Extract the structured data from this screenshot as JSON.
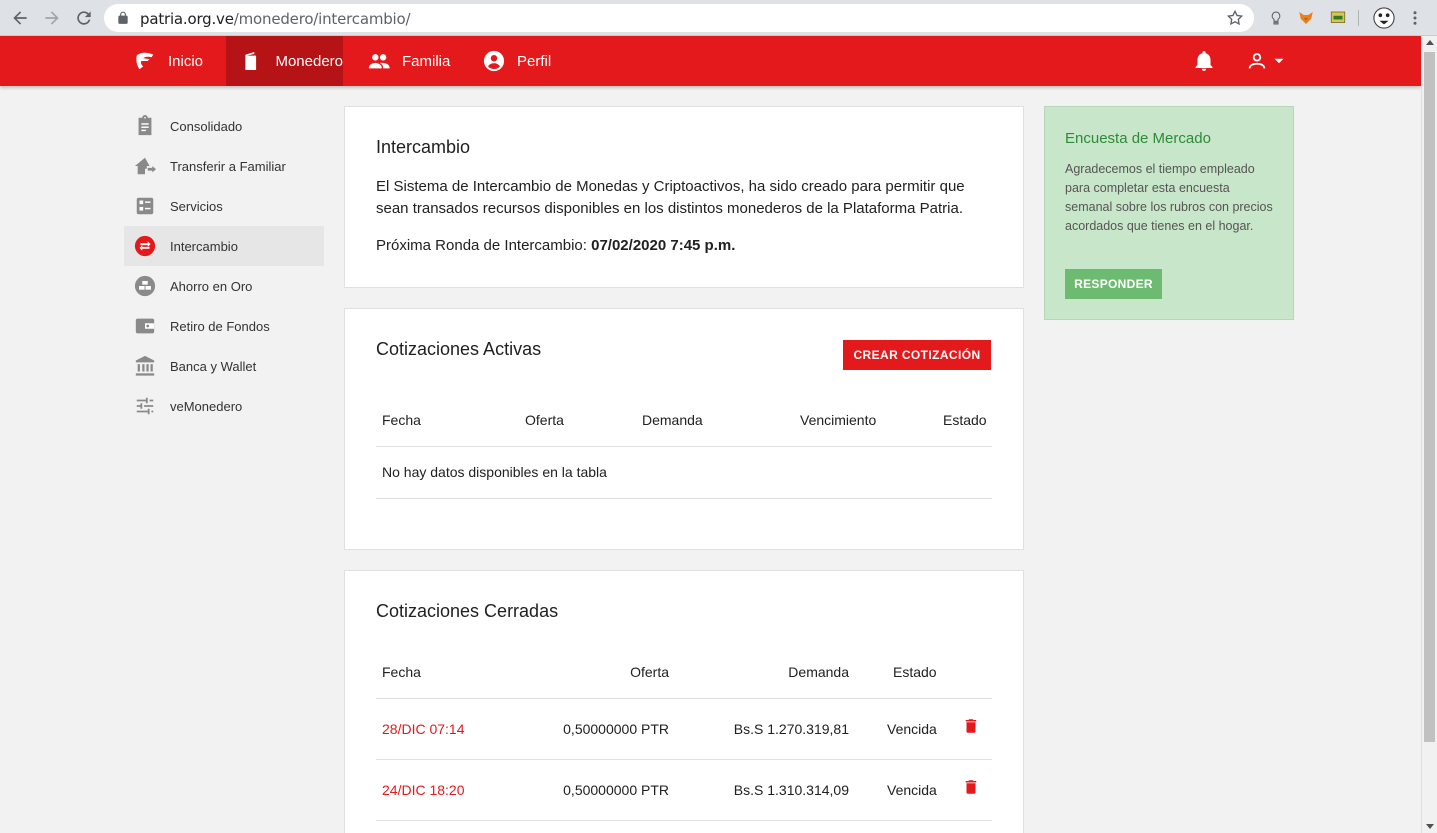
{
  "browser": {
    "url_host": "patria.org.ve",
    "url_path": "/monedero/intercambio/"
  },
  "topnav": {
    "items": [
      {
        "label": "Inicio",
        "icon": "patria-logo-icon"
      },
      {
        "label": "Monedero",
        "icon": "wallet-icon",
        "active": true
      },
      {
        "label": "Familia",
        "icon": "people-icon"
      },
      {
        "label": "Perfil",
        "icon": "account-circle-icon"
      }
    ]
  },
  "sidebar": {
    "items": [
      {
        "label": "Consolidado",
        "icon": "clipboard-icon"
      },
      {
        "label": "Transferir a Familiar",
        "icon": "home-transfer-icon"
      },
      {
        "label": "Servicios",
        "icon": "list-icon"
      },
      {
        "label": "Intercambio",
        "icon": "swap-icon",
        "active": true
      },
      {
        "label": "Ahorro en Oro",
        "icon": "gold-bars-icon"
      },
      {
        "label": "Retiro de Fondos",
        "icon": "wallet-withdraw-icon"
      },
      {
        "label": "Banca y Wallet",
        "icon": "bank-icon"
      },
      {
        "label": "veMonedero",
        "icon": "sliders-icon"
      }
    ]
  },
  "intro": {
    "title": "Intercambio",
    "description": "El Sistema de Intercambio de Monedas y Criptoactivos, ha sido creado para permitir que sean transados recursos disponibles en los distintos monederos de la Plataforma Patria.",
    "round_label": "Próxima Ronda de Intercambio: ",
    "round_value": "07/02/2020 7:45 p.m."
  },
  "active_quotes": {
    "title": "Cotizaciones Activas",
    "create_button": "CREAR COTIZACIÓN",
    "columns": [
      "Fecha",
      "Oferta",
      "Demanda",
      "Vencimiento",
      "Estado"
    ],
    "empty_message": "No hay datos disponibles en la tabla"
  },
  "closed_quotes": {
    "title": "Cotizaciones Cerradas",
    "columns": [
      "Fecha",
      "Oferta",
      "Demanda",
      "Estado"
    ],
    "rows": [
      {
        "fecha": "28/DIC 07:14",
        "oferta": "0,50000000 PTR",
        "demanda": "Bs.S 1.270.319,81",
        "estado": "Vencida"
      },
      {
        "fecha": "24/DIC 18:20",
        "oferta": "0,50000000 PTR",
        "demanda": "Bs.S 1.310.314,09",
        "estado": "Vencida"
      }
    ]
  },
  "survey": {
    "title": "Encuesta de Mercado",
    "text": "Agradecemos el tiempo empleado para completar esta encuesta semanal sobre los rubros con precios acordados que tienes en el hogar.",
    "button": "RESPONDER"
  },
  "colors": {
    "brand_red": "#e3191c",
    "active_nav": "#b51316",
    "survey_bg": "#c8e6c9",
    "survey_button": "#6dbb71"
  }
}
